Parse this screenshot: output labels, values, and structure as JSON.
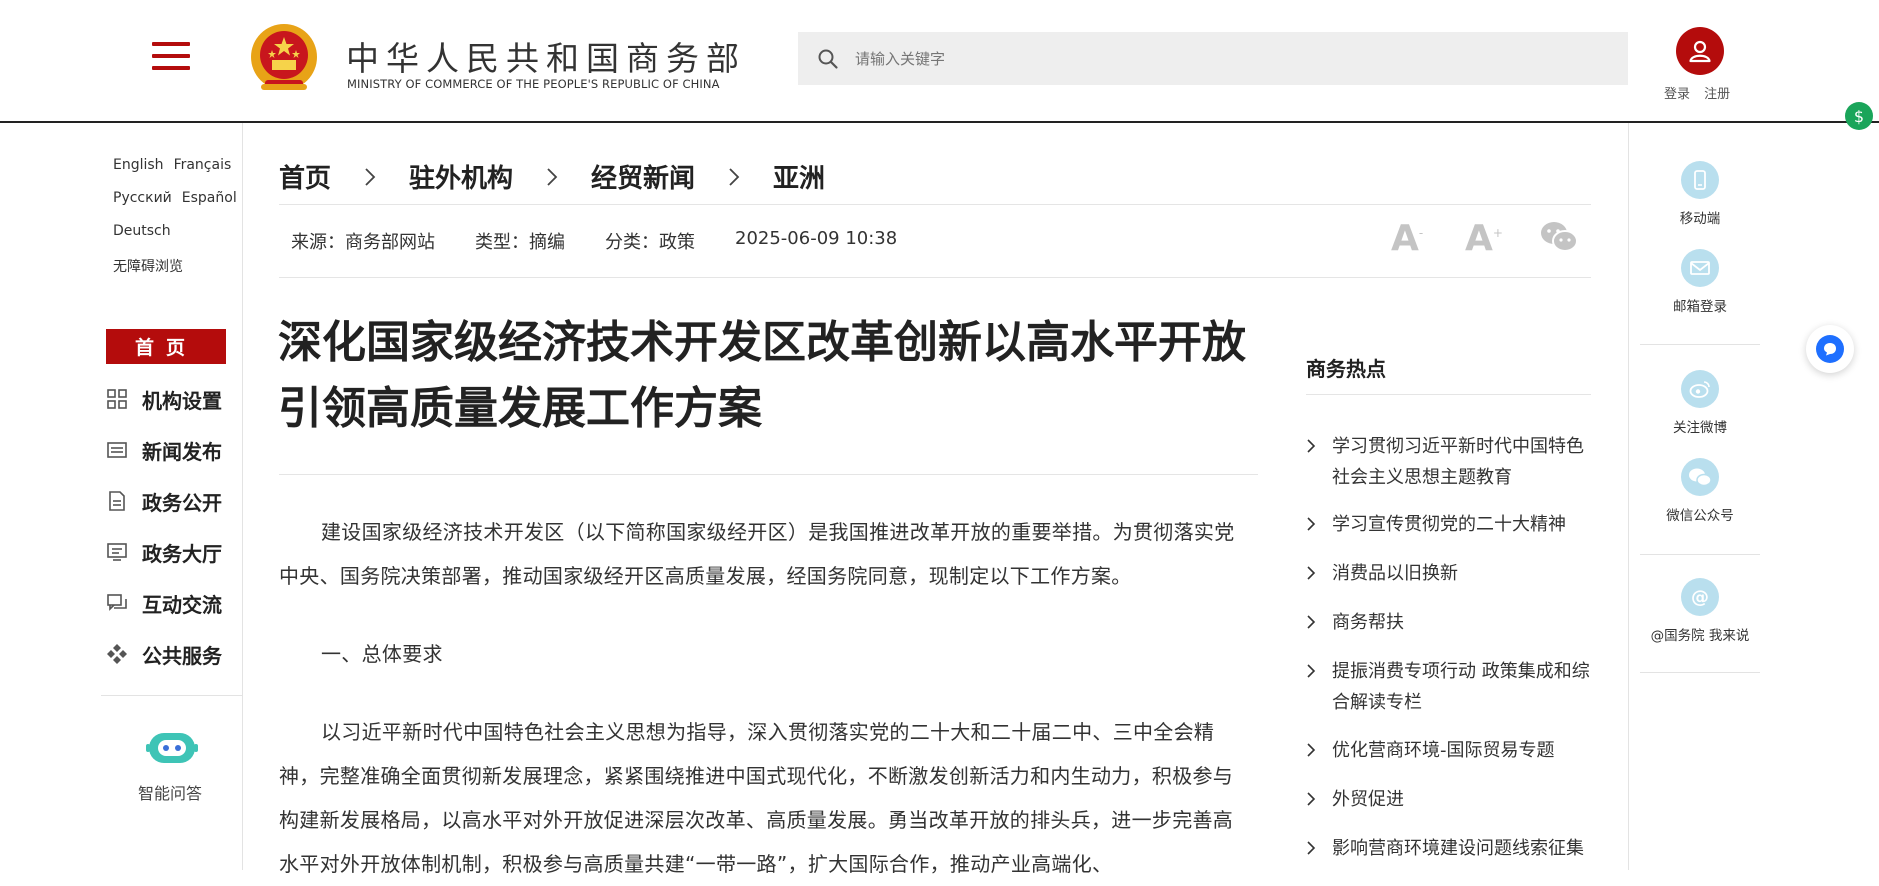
{
  "header": {
    "title_cn": "中华人民共和国商务部",
    "title_en": "MINISTRY OF COMMERCE OF THE PEOPLE'S REPUBLIC OF CHINA",
    "search_placeholder": "请输入关键字",
    "login_label": "登录",
    "register_label": "注册"
  },
  "sidebar": {
    "languages": [
      [
        "English",
        "Français"
      ],
      [
        "Русский",
        "Español"
      ],
      [
        "Deutsch"
      ],
      [
        "无障碍浏览"
      ]
    ],
    "home_label": "首页",
    "items": [
      {
        "label": "机构设置",
        "icon": "org-grid-icon"
      },
      {
        "label": "新闻发布",
        "icon": "news-icon"
      },
      {
        "label": "政务公开",
        "icon": "document-icon"
      },
      {
        "label": "政务大厅",
        "icon": "hall-icon"
      },
      {
        "label": "互动交流",
        "icon": "chat-icon"
      },
      {
        "label": "公共服务",
        "icon": "service-icon"
      }
    ],
    "assistant_label": "智能问答"
  },
  "breadcrumb": [
    "首页",
    "驻外机构",
    "经贸新闻",
    "亚洲"
  ],
  "meta": {
    "source": "来源：商务部网站",
    "type": "类型：摘编",
    "category": "分类：政策",
    "date": "2025-06-09 10:38"
  },
  "tools": {
    "font_small": "A",
    "font_large": "A",
    "minus_sign": "-",
    "plus_sign": "+"
  },
  "article": {
    "title_line1": "深化国家级经济技术开发区改革创新以高水平开放",
    "title_line2": "引领高质量发展工作方案",
    "paragraphs": [
      "建设国家级经济技术开发区（以下简称国家级经开区）是我国推进改革开放的重要举措。为贯彻落实党中央、国务院决策部署，推动国家级经开区高质量发展，经国务院同意，现制定以下工作方案。",
      "一、总体要求",
      "以习近平新时代中国特色社会主义思想为指导，深入贯彻落实党的二十大和二十届二中、三中全会精神，完整准确全面贯彻新发展理念，紧紧围绕推进中国式现代化，不断激发创新活力和内生动力，积极参与构建新发展格局，以高水平对外开放促进深层次改革、高质量发展。勇当改革开放的排头兵，进一步完善高水平对外开放体制机制，积极参与高质量共建“一带一路”，扩大国际合作，推动产业高端化、"
    ]
  },
  "hot": {
    "title": "商务热点",
    "items": [
      "学习贯彻习近平新时代中国特色社会主义思想主题教育",
      "学习宣传贯彻党的二十大精神",
      "消费品以旧换新",
      "商务帮扶",
      "提振消费专项行动 政策集成和综合解读专栏",
      "优化营商环境-国际贸易专题",
      "外贸促进",
      "影响营商环境建设问题线索征集"
    ]
  },
  "rail": {
    "mobile": "移动端",
    "mail": "邮箱登录",
    "weibo": "关注微博",
    "wechat": "微信公众号",
    "at_symbol": "@",
    "state_council": "@国务院 我来说"
  },
  "colors": {
    "accent_red": "#b40c0c",
    "rail_icon_blue": "#b9dfee",
    "float_blue": "#1e6fff",
    "float_green": "#1aa55a"
  }
}
